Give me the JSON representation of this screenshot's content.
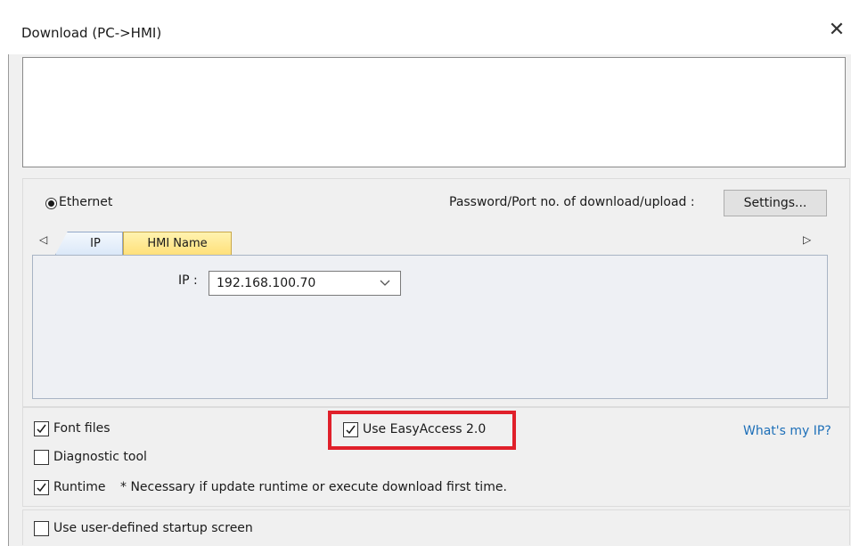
{
  "window": {
    "title": "Download (PC->HMI)",
    "close_glyph": "✕"
  },
  "connection": {
    "ethernet_label": "Ethernet",
    "ethernet_selected": true,
    "password_port_label": "Password/Port no. of download/upload :",
    "settings_button": "Settings..."
  },
  "tabs": {
    "items": [
      {
        "label": "IP",
        "active": true
      },
      {
        "label": "HMI Name",
        "active": false
      }
    ],
    "scroll_left_glyph": "◁",
    "scroll_right_glyph": "▷"
  },
  "ip_field": {
    "label": "IP :",
    "value": "192.168.100.70"
  },
  "options": {
    "font_files": {
      "label": "Font files",
      "checked": true
    },
    "use_easyaccess": {
      "label": "Use EasyAccess 2.0",
      "checked": true
    },
    "diagnostic_tool": {
      "label": "Diagnostic tool",
      "checked": false
    },
    "runtime": {
      "label": "Runtime",
      "checked": true
    },
    "runtime_note": "* Necessary if update runtime or execute download first time.",
    "whats_my_ip": "What's my IP?",
    "user_defined_startup": {
      "label": "Use user-defined startup screen",
      "checked": false
    }
  },
  "colors": {
    "highlight": "#e0202a",
    "link": "#1d6fb8",
    "tab_active": "#dbe8f8",
    "tab_inactive": "#ffe680"
  }
}
